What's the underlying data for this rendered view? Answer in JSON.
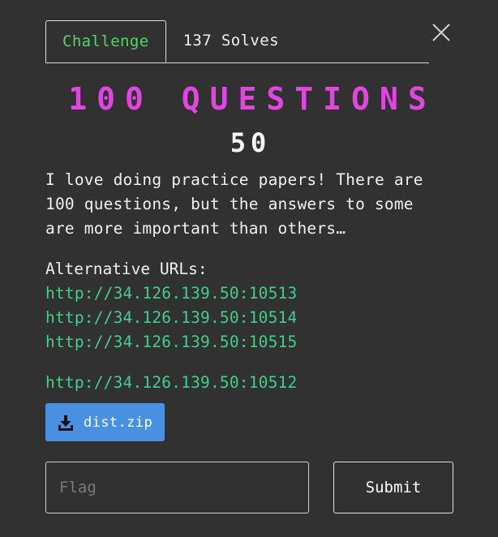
{
  "tabs": {
    "challenge_label": "Challenge",
    "solves_label": "137 Solves"
  },
  "challenge": {
    "name": "100 QUESTIONS",
    "points": "50",
    "description": "I love doing practice papers! There are 100 questions, but the answers to some are more important than others…"
  },
  "alternatives": {
    "label": "Alternative URLs:",
    "urls": [
      "http://34.126.139.50:10513",
      "http://34.126.139.50:10514",
      "http://34.126.139.50:10515"
    ]
  },
  "primary_url": "http://34.126.139.50:10512",
  "download": {
    "icon": "download-icon",
    "label": "dist.zip"
  },
  "flag_form": {
    "placeholder": "Flag",
    "value": "",
    "submit_label": "Submit"
  },
  "icons": {
    "close": "close-icon"
  },
  "colors": {
    "background": "#313131",
    "active_tab": "#4cd964",
    "title": "#e146e1",
    "link": "#3fcf8e",
    "download_button": "#4a90e2"
  }
}
